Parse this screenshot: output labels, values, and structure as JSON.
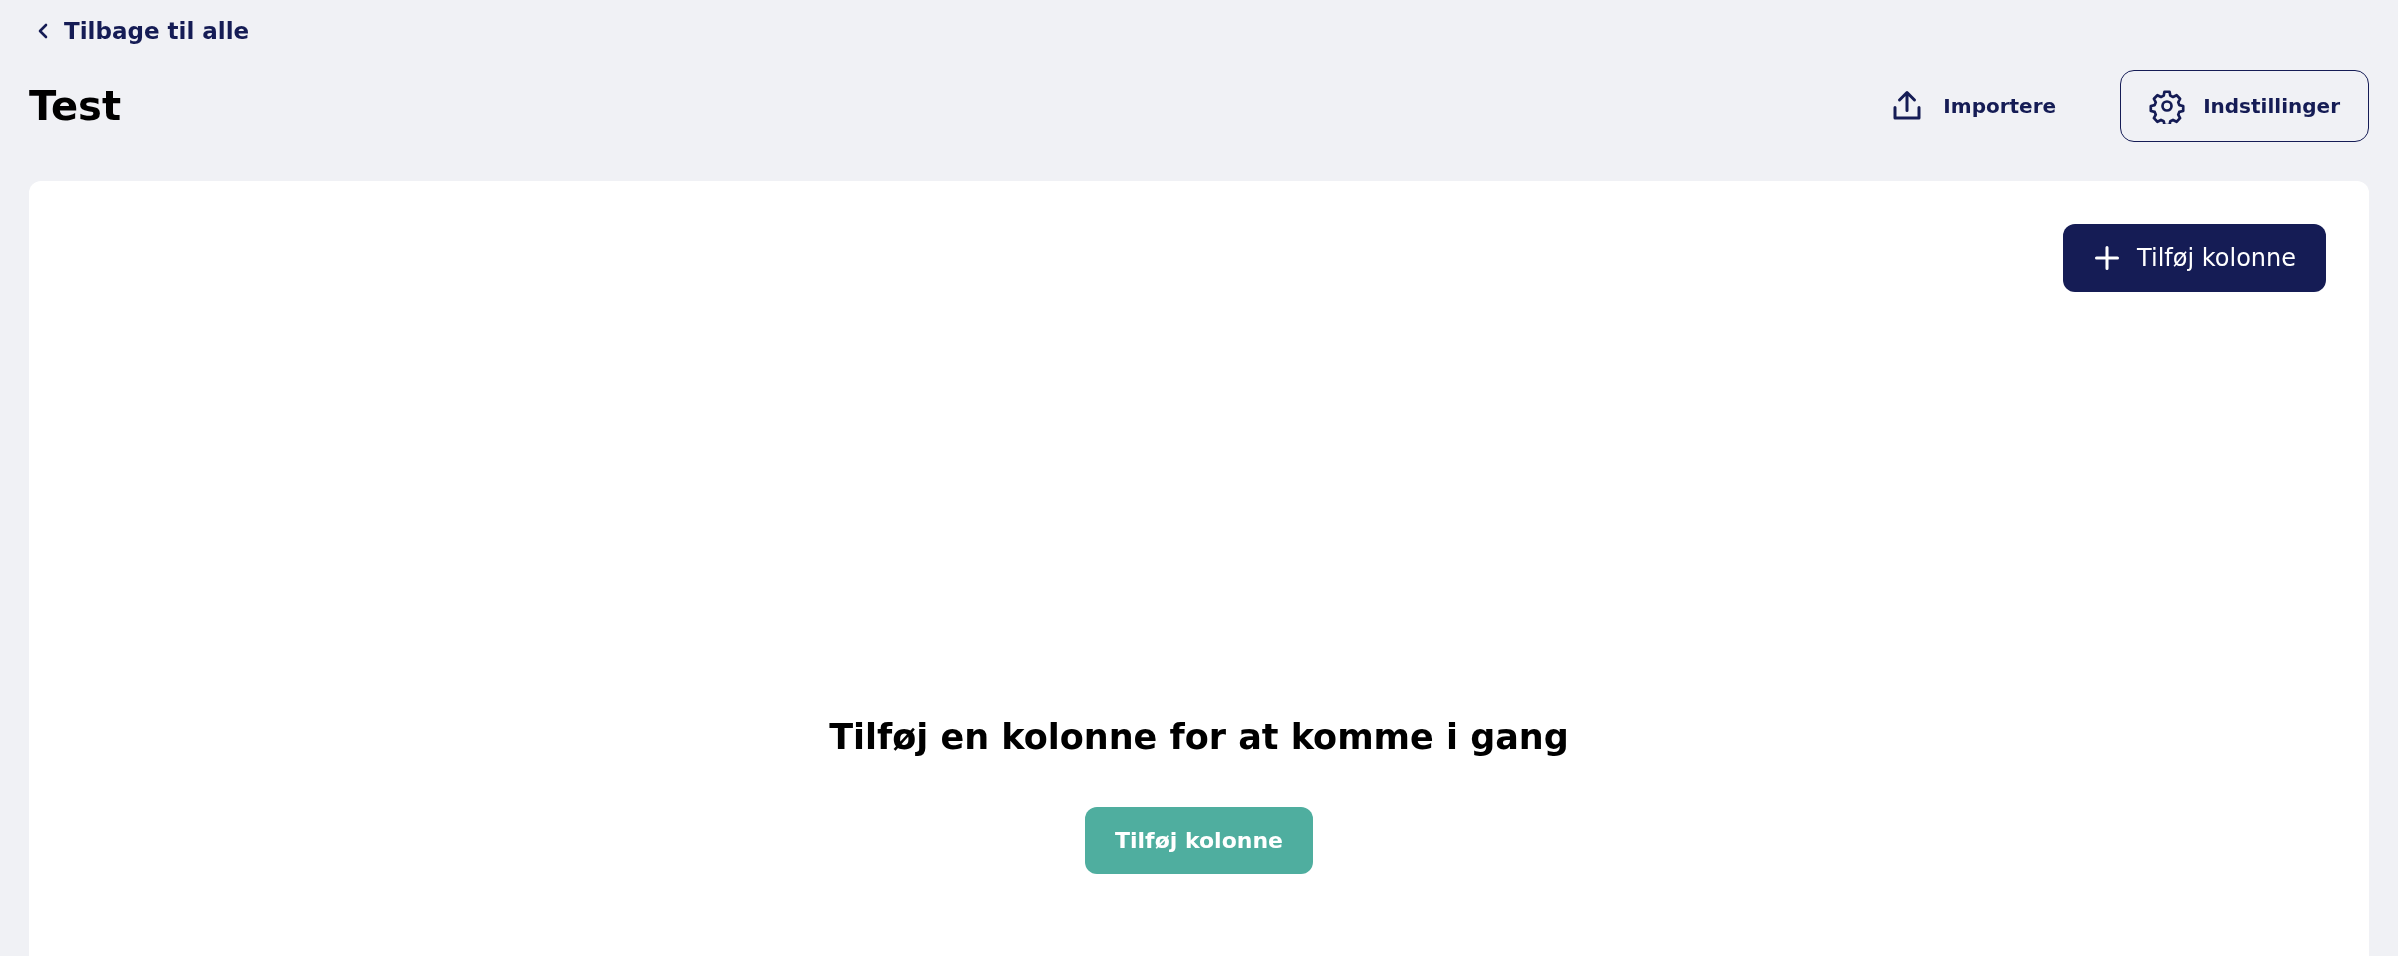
{
  "back_link": {
    "label": "Tilbage til alle"
  },
  "page_title": "Test",
  "header_actions": [
    {
      "kind": "import",
      "label": "Importere"
    },
    {
      "kind": "settings",
      "label": "Indstillinger"
    }
  ],
  "board": {
    "add_column_button": "Tilføj kolonne",
    "empty_state": {
      "message": "Tilføj en kolonne for at komme i gang",
      "button": "Tilføj kolonne"
    }
  }
}
